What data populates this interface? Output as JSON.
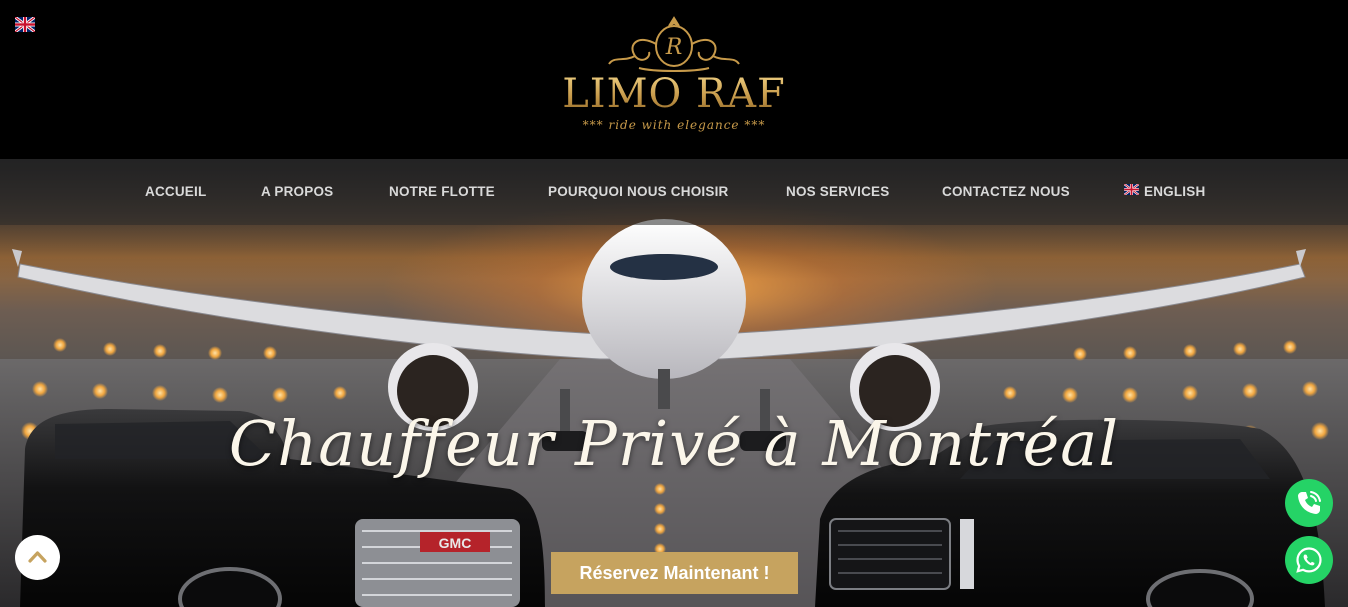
{
  "header": {
    "language_flag": "uk-flag-icon",
    "logo": {
      "name": "LIMO RAF",
      "tagline": "*** ride with elegance ***",
      "emblem": "crown-emblem-icon"
    }
  },
  "nav": {
    "items": [
      {
        "label": "ACCUEIL"
      },
      {
        "label": "A PROPOS"
      },
      {
        "label": "NOTRE FLOTTE"
      },
      {
        "label": "POURQUOI NOUS CHOISIR"
      },
      {
        "label": "NOS SERVICES"
      },
      {
        "label": "CONTACTEZ NOUS"
      },
      {
        "label": "ENGLISH",
        "icon": "uk-flag-icon"
      }
    ]
  },
  "hero": {
    "headline": "Chauffeur Privé à Montréal",
    "cta_label": "Réservez Maintenant !"
  },
  "floating": {
    "scroll_top_icon": "chevron-up-icon",
    "phone_icon": "phone-icon",
    "whatsapp_icon": "whatsapp-icon"
  },
  "colors": {
    "gold": "#c6a35f",
    "nav_text": "#d9d9d9",
    "whatsapp_green": "#25d366"
  }
}
